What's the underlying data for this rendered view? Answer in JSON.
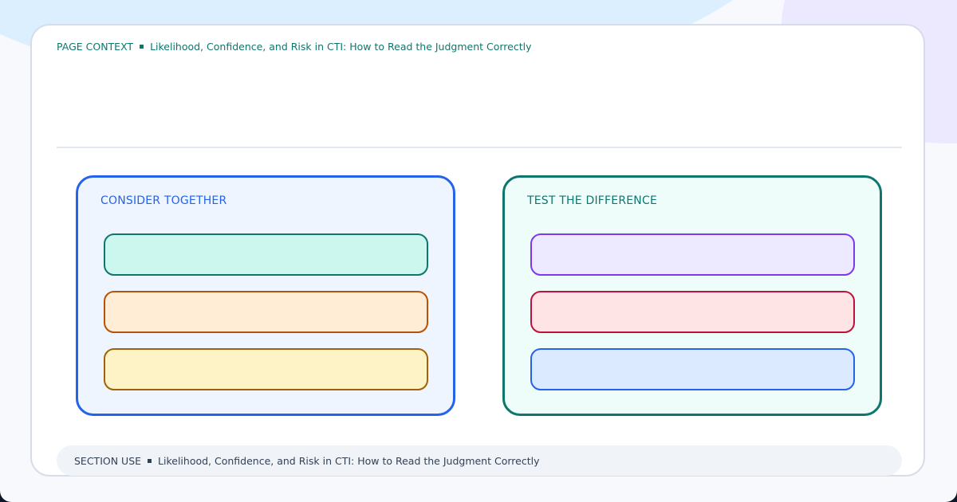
{
  "header": {
    "context_label": "PAGE CONTEXT",
    "context_text": "Likelihood, Confidence, and Risk in CTI: How to Read the Judgment Correctly"
  },
  "panels": [
    {
      "title": "CONSIDER TOGETHER",
      "accent": "#2563eb",
      "background": "#eef5ff",
      "items": [
        {
          "fill": "#ccf7ee",
          "border": "#0f766e"
        },
        {
          "fill": "#ffedd5",
          "border": "#b45309"
        },
        {
          "fill": "#fef3c7",
          "border": "#a16207"
        }
      ]
    },
    {
      "title": "TEST THE DIFFERENCE",
      "accent": "#0f766e",
      "background": "#effdfa",
      "items": [
        {
          "fill": "#ede9fe",
          "border": "#7c3aed"
        },
        {
          "fill": "#ffe4e6",
          "border": "#be123c"
        },
        {
          "fill": "#dbeafe",
          "border": "#2563eb"
        }
      ]
    }
  ],
  "footer": {
    "section_label": "SECTION USE",
    "section_text": "Likelihood, Confidence, and Risk in CTI: How to Read the Judgment Correctly"
  }
}
